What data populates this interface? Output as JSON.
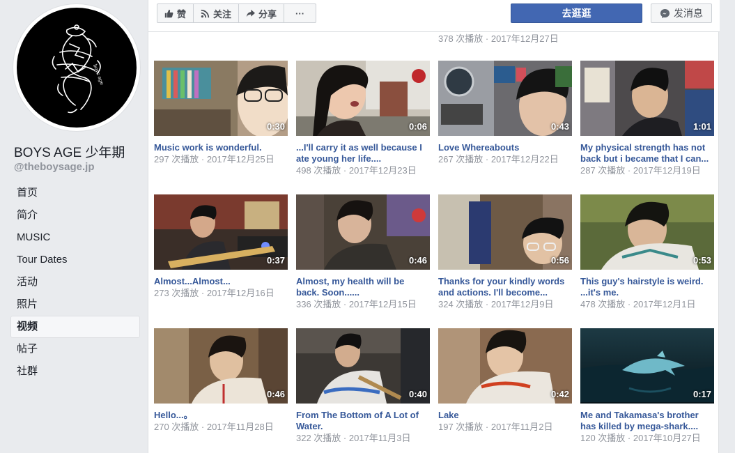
{
  "page": {
    "name": "BOYS AGE 少年期",
    "handle": "@theboysage.jp"
  },
  "nav": [
    {
      "label": "首页",
      "active": false
    },
    {
      "label": "简介",
      "active": false
    },
    {
      "label": "MUSIC",
      "active": false
    },
    {
      "label": "Tour Dates",
      "active": false
    },
    {
      "label": "活动",
      "active": false
    },
    {
      "label": "照片",
      "active": false
    },
    {
      "label": "视频",
      "active": true
    },
    {
      "label": "帖子",
      "active": false
    },
    {
      "label": "社群",
      "active": false
    }
  ],
  "actions": {
    "like_label": "赞",
    "follow_label": "关注",
    "share_label": "分享",
    "more_label": "···",
    "primary_label": "去逛逛",
    "message_label": "发消息"
  },
  "icons": {
    "like": "thumbs-up-icon",
    "follow": "rss-icon",
    "share": "share-arrow-icon",
    "message": "messenger-icon"
  },
  "colors": {
    "accent": "#4267b2",
    "link": "#365899",
    "muted": "#90949c",
    "background": "#e9ebee"
  },
  "previous_row_meta": "378 次播放 · 2017年12月27日",
  "videos": [
    {
      "title": "Music work is wonderful.",
      "meta": "297 次播放 · 2017年12月25日",
      "duration": "0:30"
    },
    {
      "title": "...I'll carry it as well because I ate young her life....",
      "meta": "498 次播放 · 2017年12月23日",
      "duration": "0:06"
    },
    {
      "title": "Love Whereabouts",
      "meta": "267 次播放 · 2017年12月22日",
      "duration": "0:43"
    },
    {
      "title": "My physical strength has not back but i became that I can...",
      "meta": "287 次播放 · 2017年12月19日",
      "duration": "1:01"
    },
    {
      "title": "Almost...Almost...",
      "meta": "273 次播放 · 2017年12月16日",
      "duration": "0:37"
    },
    {
      "title": "Almost, my health will be back. Soon......",
      "meta": "336 次播放 · 2017年12月15日",
      "duration": "0:46"
    },
    {
      "title": "Thanks for your kindly words and actions. I'll become...",
      "meta": "324 次播放 · 2017年12月9日",
      "duration": "0:56"
    },
    {
      "title": "This guy's hairstyle is weird. ...it's me.",
      "meta": "478 次播放 · 2017年12月1日",
      "duration": "0:53"
    },
    {
      "title": "Hello...。",
      "meta": "270 次播放 · 2017年11月28日",
      "duration": "0:46"
    },
    {
      "title": "From The Bottom of A Lot of Water.",
      "meta": "322 次播放 · 2017年11月3日",
      "duration": "0:40"
    },
    {
      "title": "Lake",
      "meta": "197 次播放 · 2017年11月2日",
      "duration": "0:42"
    },
    {
      "title": "Me and Takamasa's brother has killed by mega-shark....",
      "meta": "120 次播放 · 2017年10月27日",
      "duration": "0:17"
    }
  ]
}
